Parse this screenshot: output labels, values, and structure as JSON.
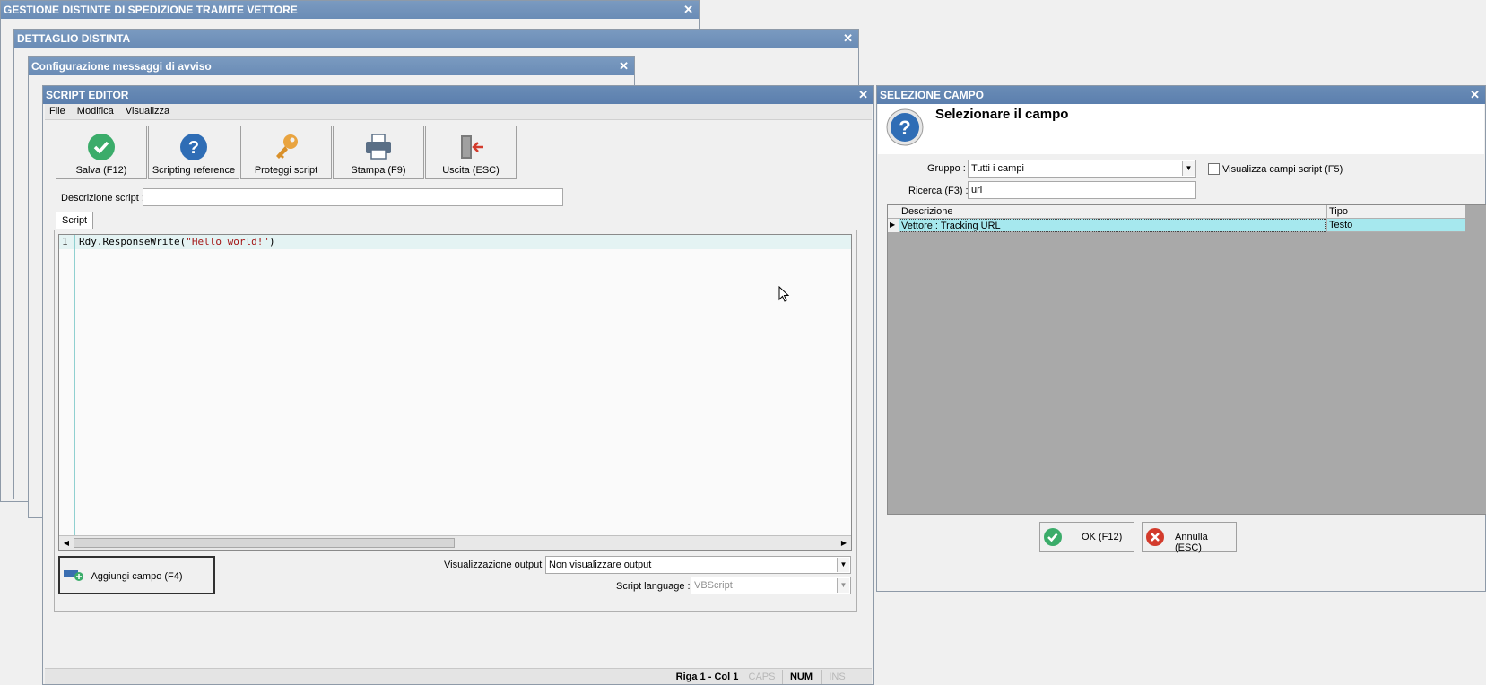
{
  "windows": {
    "gestione": {
      "title": "GESTIONE DISTINTE DI SPEDIZIONE TRAMITE VETTORE"
    },
    "dettaglio": {
      "title": "DETTAGLIO DISTINTA"
    },
    "configurazione": {
      "title": "Configurazione messaggi di avviso"
    }
  },
  "script_editor": {
    "title": "SCRIPT EDITOR",
    "menu": [
      "File",
      "Modifica",
      "Visualizza"
    ],
    "toolbar": [
      {
        "label": "Salva (F12)",
        "icon": "check-circle-icon",
        "color": "#3bac6a"
      },
      {
        "label": "Scripting reference",
        "icon": "question-circle-icon",
        "color": "#2f6db5"
      },
      {
        "label": "Proteggi script",
        "icon": "key-icon",
        "color": "#e9a440"
      },
      {
        "label": "Stampa (F9)",
        "icon": "printer-icon",
        "color": "#5a6f86"
      },
      {
        "label": "Uscita (ESC)",
        "icon": "exit-door-icon",
        "color": "#d33b2c"
      }
    ],
    "description_label": "Descrizione script :",
    "description_value": "",
    "tab": "Script",
    "line_number": "1",
    "code_prefix": "Rdy.ResponseWrite(",
    "code_string": "\"Hello world!\"",
    "code_suffix": ")",
    "add_field_button": "Aggiungi campo (F4)",
    "output_label": "Visualizzazione output :",
    "output_value": "Non visualizzare output",
    "language_label": "Script language :",
    "language_value": "VBScript",
    "status": {
      "position": "Riga 1 - Col 1",
      "caps": "CAPS",
      "num": "NUM",
      "ins": "INS"
    }
  },
  "selezione_campo": {
    "title": "SELEZIONE CAMPO",
    "heading": "Selezionare il campo",
    "group_label": "Gruppo :",
    "group_value": "Tutti i campi",
    "show_script_fields": "Visualizza campi script (F5)",
    "search_label": "Ricerca (F3) :",
    "search_value": "url",
    "columns": [
      "Descrizione",
      "Tipo"
    ],
    "rows": [
      {
        "descrizione": "Vettore : Tracking URL",
        "tipo": "Testo"
      }
    ],
    "ok_button": "OK (F12)",
    "cancel_button": "Annulla (ESC)"
  }
}
